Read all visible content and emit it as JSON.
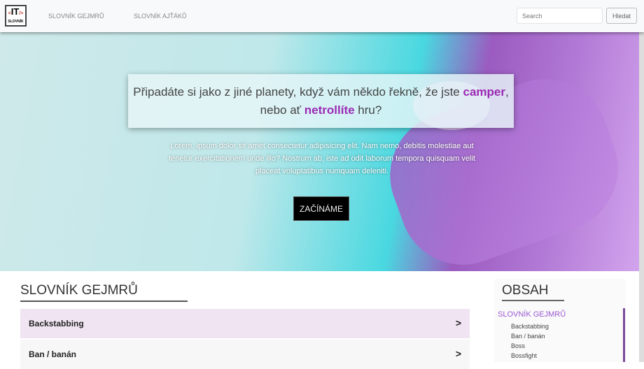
{
  "nav": {
    "logo_main": "IT",
    "logo_sub": "SLOVNÍK",
    "logo_left": "<",
    "logo_right": "/>",
    "links": [
      "SLOVNÍK GEJMRŮ",
      "SLOVNÍK AJŤÁKŮ"
    ],
    "search_placeholder": "Search",
    "search_button": "Hledat"
  },
  "hero": {
    "q1": "Připadáte si jako z jiné planety, když vám někdo řekně, že jste ",
    "w1": "camper",
    "q2": ",",
    "q3": "nebo ať ",
    "w2": "netrollíte",
    "q4": " hru?",
    "lorem": "Lorem, ipsum dolor sit amet consectetur adipisicing elit. Nam nemo, debitis molestiae aut tenetur exercitationem unde illo? Nostrum ab, iste ad odit laborum tempora quisquam velit placeat voluptatibus numquam deleniti.",
    "button": "ZAČÍNÁME"
  },
  "main": {
    "title": "SLOVNÍK GEJMRŮ",
    "entries": [
      {
        "label": "Backstabbing",
        "chevron": ">"
      },
      {
        "label": "Ban / banán",
        "chevron": ">"
      }
    ]
  },
  "sidebar": {
    "title": "OBSAH",
    "section": "SLOVNÍK GEJMRŮ",
    "items": [
      "Backstabbing",
      "Ban / banán",
      "Boss",
      "Bossfight"
    ]
  }
}
